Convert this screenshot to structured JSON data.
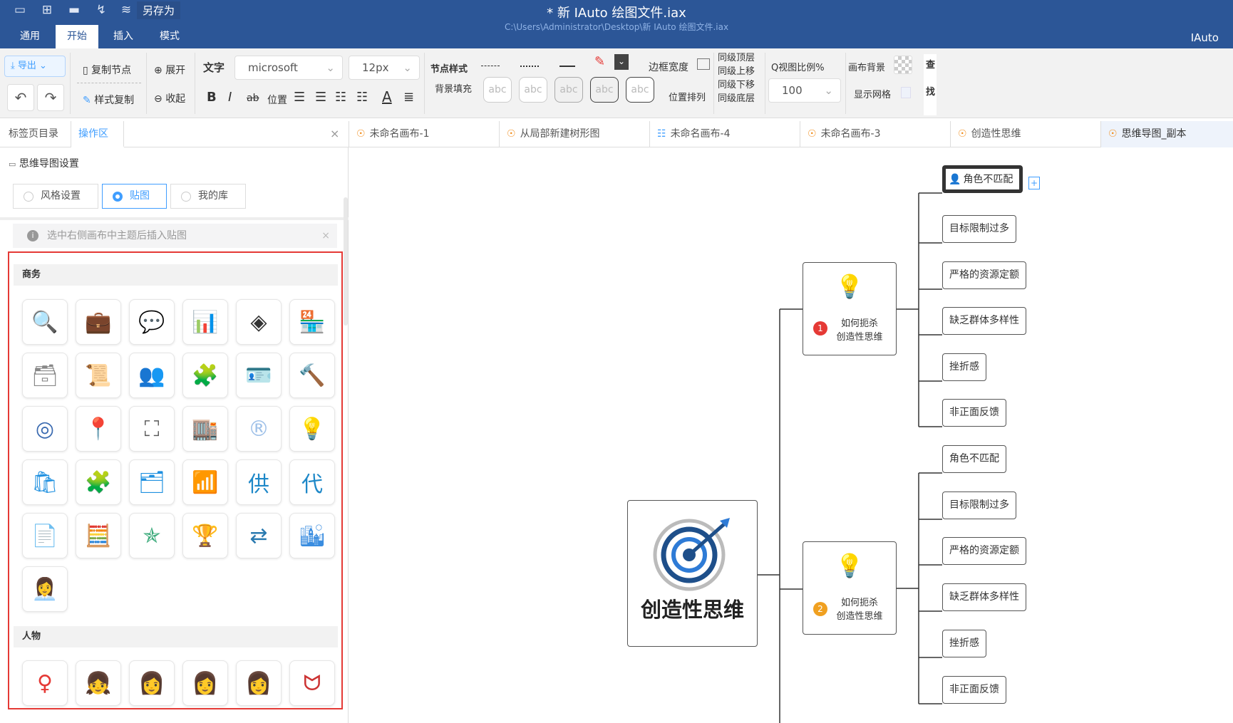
{
  "titlebar": {
    "title": "* 新 IAuto 绘图文件.iax",
    "path": "C:\\Users\\Administrator\\Desktop\\新 IAuto 绘图文件.iax",
    "brand": "IAuto",
    "save_as": "另存为"
  },
  "menu_tabs": [
    "通用",
    "开始",
    "插入",
    "模式"
  ],
  "toolbar": {
    "export": "导出",
    "copy_node": "复制节点",
    "style_copy": "样式复制",
    "expand": "展开",
    "collapse": "收起",
    "text": "文字",
    "font": "microsoft",
    "size": "12px",
    "position": "位置",
    "node_style": "节点样式",
    "bg_fill": "背景填充",
    "abc": "abc",
    "border_width": "边框宽度",
    "position_arrange": "位置排列",
    "layer": [
      "同级顶层",
      "同级上移",
      "同级下移",
      "同级底层"
    ],
    "zoom_label": "Q视图比例%",
    "zoom": "100",
    "canvas_bg": "画布背景",
    "show_grid": "显示网格",
    "find1": "查",
    "find2": "找",
    "bold": "B",
    "italic": "I",
    "strike": "ab",
    "color_a": "A"
  },
  "panel_tabs": [
    "标签页目录",
    "操作区"
  ],
  "doc_tabs": [
    "未命名画布-1",
    "从局部新建树形图",
    "未命名画布-4",
    "未命名画布-3",
    "创造性思维",
    "思维导图_副本"
  ],
  "panel": {
    "title": "思维导图设置",
    "radios": [
      "风格设置",
      "贴图",
      "我的库"
    ],
    "info": "选中右侧画布中主题后插入贴图",
    "sections": [
      "商务",
      "人物"
    ]
  },
  "canvas": {
    "root": "创造性思维",
    "subs": [
      {
        "num": "1",
        "line1": "如何扼杀",
        "line2": "创造性思维"
      },
      {
        "num": "2",
        "line1": "如何扼杀",
        "line2": "创造性思维"
      }
    ],
    "leaves": [
      "角色不匹配",
      "目标限制过多",
      "严格的资源定额",
      "缺乏群体多样性",
      "挫折感",
      "非正面反馈",
      "角色不匹配",
      "目标限制过多",
      "严格的资源定额",
      "缺乏群体多样性",
      "挫折感",
      "非正面反馈"
    ]
  },
  "colors": {
    "brand": "#2c5697",
    "accent": "#409eff",
    "highlight": "#e53935"
  }
}
